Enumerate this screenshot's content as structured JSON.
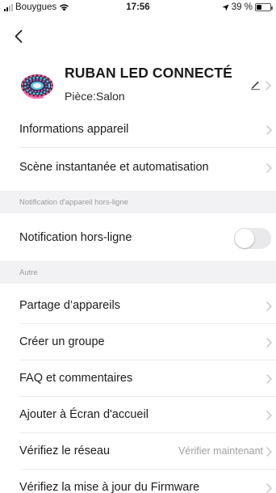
{
  "status_bar": {
    "carrier": "Bouygues",
    "time": "17:56",
    "battery_percent": "39 %",
    "battery_level": 0.39
  },
  "device": {
    "name": "RUBAN LED CONNECTÉ",
    "room": "Pièce:Salon"
  },
  "menu": {
    "device_info": "Informations appareil",
    "scene_automation": "Scène instantanée et automatisation",
    "offline_section": "Notification d'appareil hors-ligne",
    "offline_notification": "Notification hors-ligne",
    "offline_notification_enabled": false,
    "other_section": "Autre",
    "share_device": "Partage d’appareils",
    "create_group": "Créer un groupe",
    "faq": "FAQ et commentaires",
    "add_home_screen": "Ajouter à Écran d'accueil",
    "check_network": "Vérifiez le réseau",
    "check_network_action": "Vérifier maintenant",
    "check_firmware": "Vérifiez la mise à jour du Firmware"
  },
  "colors": {
    "background": "#ffffff",
    "section_background": "#f2f2f4",
    "secondary_text": "#a0a0a4",
    "toggle_off": "#e9e9eb"
  },
  "icons": {
    "back": "chevron-left-icon",
    "edit": "pencil-icon",
    "row_chevron": "chevron-right-icon",
    "signal": "signal-icon",
    "wifi": "wifi-icon",
    "location": "location-arrow-icon",
    "battery": "battery-icon"
  }
}
